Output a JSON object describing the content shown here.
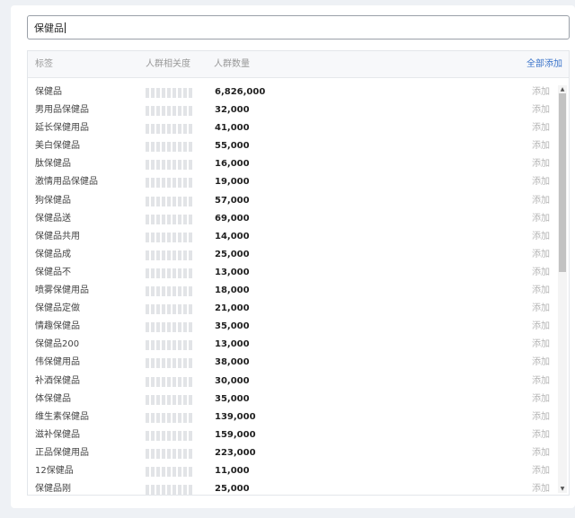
{
  "search": {
    "value": "保健品"
  },
  "table": {
    "headers": {
      "tag": "标签",
      "relevance": "人群相关度",
      "count": "人群数量",
      "add_all": "全部添加"
    },
    "add_label": "添加",
    "rows": [
      {
        "tag": "保健品",
        "count": "6,826,000"
      },
      {
        "tag": "男用品保健品",
        "count": "32,000"
      },
      {
        "tag": "延长保健用品",
        "count": "41,000"
      },
      {
        "tag": "美白保健品",
        "count": "55,000"
      },
      {
        "tag": "肽保健品",
        "count": "16,000"
      },
      {
        "tag": "激情用品保健品",
        "count": "19,000"
      },
      {
        "tag": "狗保健品",
        "count": "57,000"
      },
      {
        "tag": "保健品送",
        "count": "69,000"
      },
      {
        "tag": "保健品共用",
        "count": "14,000"
      },
      {
        "tag": "保健品成",
        "count": "25,000"
      },
      {
        "tag": "保健品不",
        "count": "13,000"
      },
      {
        "tag": "喷雾保健用品",
        "count": "18,000"
      },
      {
        "tag": "保健品定做",
        "count": "21,000"
      },
      {
        "tag": "情趣保健品",
        "count": "35,000"
      },
      {
        "tag": "保健品200",
        "count": "13,000"
      },
      {
        "tag": "伟保健用品",
        "count": "38,000"
      },
      {
        "tag": "补酒保健品",
        "count": "30,000"
      },
      {
        "tag": "体保健品",
        "count": "35,000"
      },
      {
        "tag": "维生素保健品",
        "count": "139,000"
      },
      {
        "tag": "滋补保健品",
        "count": "159,000"
      },
      {
        "tag": "正品保健用品",
        "count": "223,000"
      },
      {
        "tag": "12保健品",
        "count": "11,000"
      },
      {
        "tag": "保健品刚",
        "count": "25,000"
      }
    ]
  }
}
